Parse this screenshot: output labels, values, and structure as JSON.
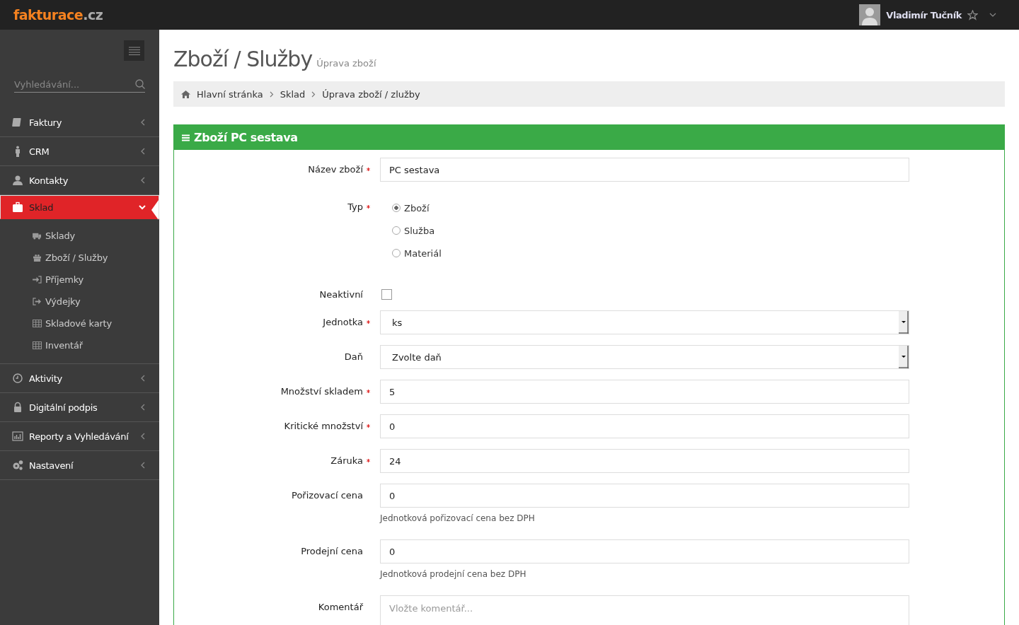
{
  "logo": {
    "name": "fakturace",
    "suffix": ".cz"
  },
  "user": {
    "name": "Vladimír Tučník"
  },
  "sidebar": {
    "search": {
      "placeholder": "Vyhledávání..."
    },
    "items": [
      {
        "label": "Faktury",
        "selected": false,
        "expanded": false
      },
      {
        "label": "CRM",
        "selected": false,
        "expanded": false
      },
      {
        "label": "Kontakty",
        "selected": false,
        "expanded": false
      },
      {
        "label": "Sklad",
        "selected": true,
        "expanded": true,
        "children": [
          {
            "label": "Sklady"
          },
          {
            "label": "Zboží / Služby"
          },
          {
            "label": "Příjemky"
          },
          {
            "label": "Výdejky"
          },
          {
            "label": "Skladové karty"
          },
          {
            "label": "Inventář"
          }
        ]
      },
      {
        "label": "Aktivity",
        "selected": false,
        "expanded": false
      },
      {
        "label": "Digitální podpis",
        "selected": false,
        "expanded": false
      },
      {
        "label": "Reporty a Vyhledávání",
        "selected": false,
        "expanded": false
      },
      {
        "label": "Nastavení",
        "selected": false,
        "expanded": false
      }
    ]
  },
  "page": {
    "title": "Zboží / Služby",
    "subtitle": "Úprava zboží"
  },
  "breadcrumb": [
    "Hlavní stránka",
    "Sklad",
    "Úprava zboží / zlužby"
  ],
  "panel": {
    "title": "Zboží PC sestava",
    "fields": [
      {
        "kind": "text",
        "label": "Název zboží",
        "required": true,
        "value": "PC sestava"
      },
      {
        "kind": "radio",
        "label": "Typ",
        "required": true,
        "options": [
          {
            "label": "Zboží",
            "selected": true
          },
          {
            "label": "Služba",
            "selected": false
          },
          {
            "label": "Materiál",
            "selected": false
          }
        ]
      },
      {
        "kind": "checkbox",
        "label": "Neaktivní",
        "required": false,
        "checked": false
      },
      {
        "kind": "select",
        "label": "Jednotka",
        "required": true,
        "value": "ks"
      },
      {
        "kind": "select",
        "label": "Daň",
        "required": false,
        "value": "Zvolte daň"
      },
      {
        "kind": "text",
        "label": "Množství skladem",
        "required": true,
        "value": "5"
      },
      {
        "kind": "text",
        "label": "Kritické množství",
        "required": true,
        "value": "0"
      },
      {
        "kind": "text",
        "label": "Záruka",
        "required": true,
        "value": "24"
      },
      {
        "kind": "text",
        "label": "Pořizovací cena",
        "required": false,
        "value": "0",
        "hint": "Jednotková pořizovací cena bez DPH"
      },
      {
        "kind": "text",
        "label": "Prodejní cena",
        "required": false,
        "value": "0",
        "hint": "Jednotková prodejní cena bez DPH"
      },
      {
        "kind": "textarea",
        "label": "Komentář",
        "required": false,
        "placeholder": "Vložte komentář..."
      }
    ]
  }
}
